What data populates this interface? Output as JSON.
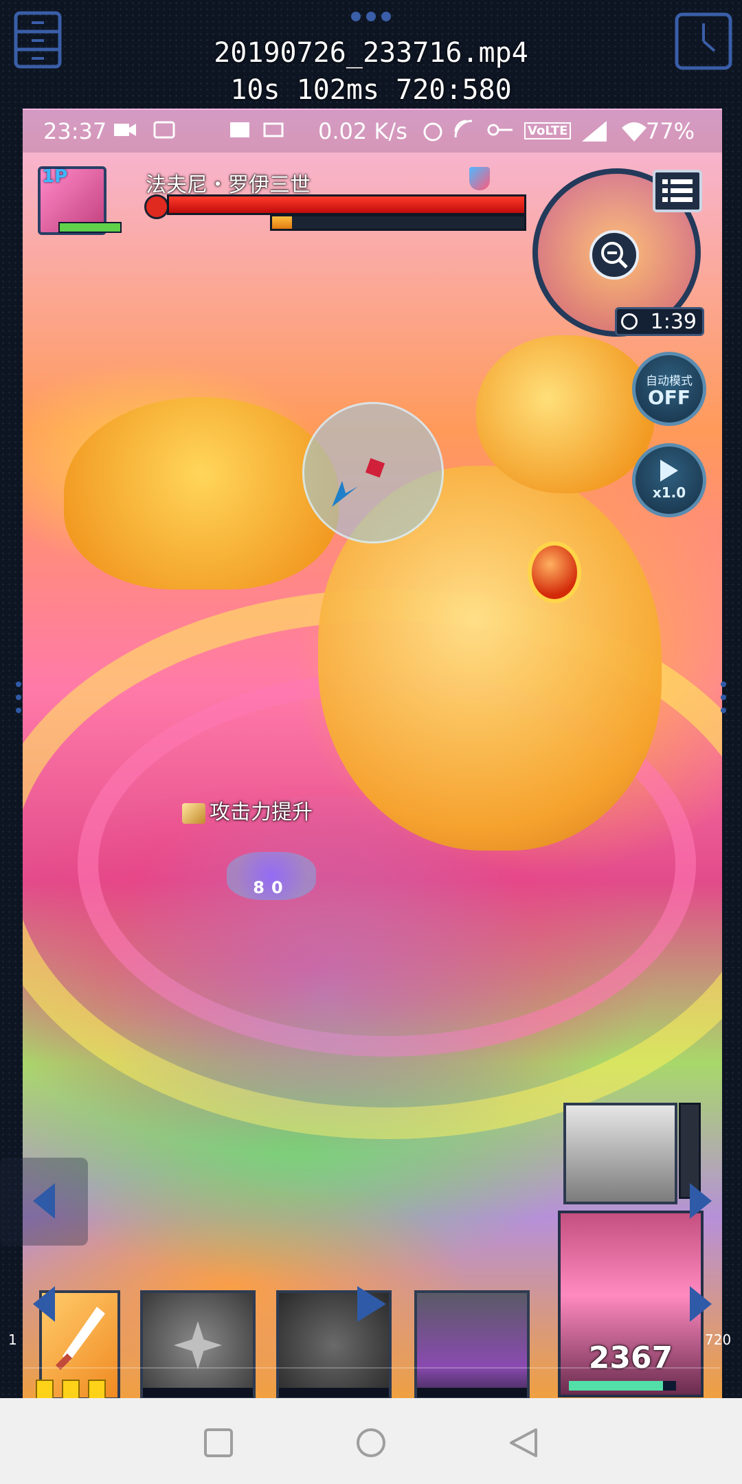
{
  "player": {
    "file_name": "20190726_233716.mp4",
    "position_info": "10s 102ms 720:580",
    "frame_start": "1",
    "frame_end": "720"
  },
  "statusbar": {
    "time": "23:37",
    "net_speed": "0.02 K/s",
    "volte": "VoLTE",
    "battery": "77%"
  },
  "game": {
    "player_tag": "1P",
    "boss_name": "法夫尼・罗伊三世",
    "boss_hp_percent": 100,
    "boss_break_percent": 8,
    "player_hp_percent": 100,
    "timer": "1:39",
    "auto_mode_label": "自动模式",
    "auto_mode_state": "OFF",
    "speed_label": "x1.0",
    "buff_text": "攻击力提升",
    "combo_count": "80",
    "leader_hp": "2367",
    "leader_hp_percent": 88,
    "energy_pips": 3
  },
  "colors": {
    "hp_red": "#d81414",
    "break_orange": "#f09020",
    "hud_blue": "#1f2e44",
    "accent_green": "#5fd14a"
  },
  "icons": {
    "top_left": "file-cabinet-icon",
    "top_center": "more-dots-icon",
    "top_right": "clock-icon",
    "nav": [
      "square-recents-icon",
      "circle-home-icon",
      "triangle-back-icon"
    ]
  }
}
